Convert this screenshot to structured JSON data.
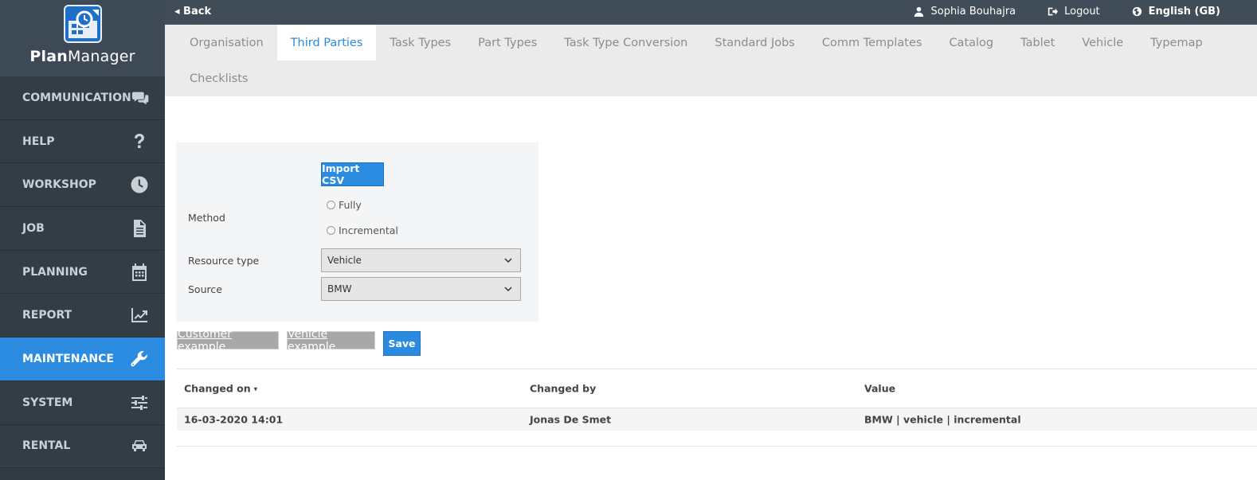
{
  "app": {
    "logo_bold": "Plan",
    "logo_rest": "Manager"
  },
  "topbar": {
    "back": "◂ Back",
    "user": "Sophia Bouhajra",
    "logout": "Logout",
    "language": "English (GB)"
  },
  "sidebar": {
    "items": [
      {
        "label": "COMMUNICATION",
        "icon": "chat-icon"
      },
      {
        "label": "HELP",
        "icon": "question-icon"
      },
      {
        "label": "WORKSHOP",
        "icon": "clock-icon"
      },
      {
        "label": "JOB",
        "icon": "document-icon"
      },
      {
        "label": "PLANNING",
        "icon": "calendar-icon"
      },
      {
        "label": "REPORT",
        "icon": "chart-icon"
      },
      {
        "label": "MAINTENANCE",
        "icon": "wrench-icon",
        "active": true
      },
      {
        "label": "SYSTEM",
        "icon": "sliders-icon"
      },
      {
        "label": "RENTAL",
        "icon": "car-icon"
      }
    ]
  },
  "tabs": [
    "Organisation",
    "Third Parties",
    "Task Types",
    "Part Types",
    "Task Type Conversion",
    "Standard Jobs",
    "Comm Templates",
    "Catalog",
    "Tablet",
    "Vehicle",
    "Typemap",
    "Checklists"
  ],
  "active_tab": "Third Parties",
  "form": {
    "import_button": "Import CSV",
    "method_label": "Method",
    "method_options": [
      "Fully",
      "Incremental"
    ],
    "resource_type_label": "Resource type",
    "resource_type_value": "Vehicle",
    "source_label": "Source",
    "source_value": "BMW"
  },
  "actions": {
    "customer_example": "Customer example",
    "vehicle_example": "Vehicle example",
    "save": "Save"
  },
  "table": {
    "headers": [
      "Changed on",
      "Changed by",
      "Value"
    ],
    "rows": [
      [
        "16-03-2020 14:01",
        "Jonas De Smet",
        "BMW | vehicle | incremental"
      ]
    ]
  },
  "colors": {
    "accent": "#2b8be0",
    "sidebar": "#2f3a43",
    "topbar": "#404c57"
  }
}
